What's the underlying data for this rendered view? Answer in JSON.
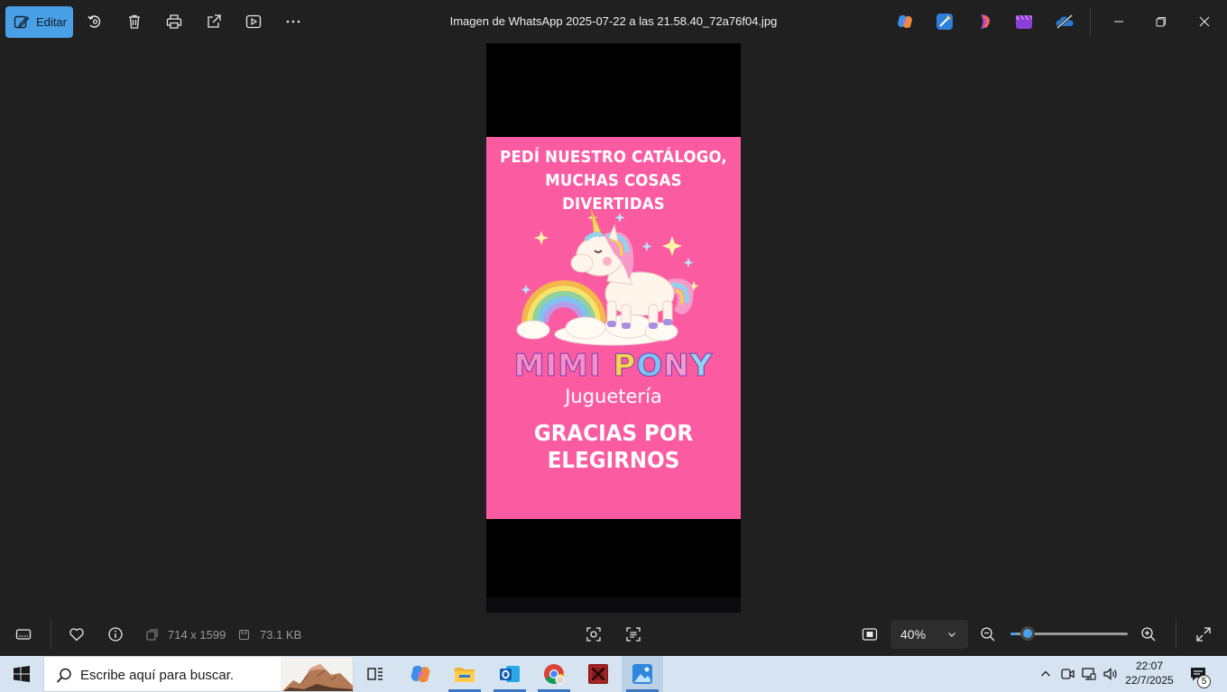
{
  "toolbar": {
    "edit_label": "Editar",
    "window_title": "Imagen de WhatsApp 2025-07-22 a las 21.58.40_72a76f04.jpg",
    "icons": [
      "edit-icon",
      "rotate-icon",
      "delete-icon",
      "print-icon",
      "share-icon",
      "slideshow-icon",
      "more-icon"
    ],
    "app_icons": [
      "copilot-icon",
      "designer-icon",
      "clipchamp-icon",
      "video-editor-icon",
      "onedrive-icon"
    ]
  },
  "image": {
    "headline_line1": "PEDÍ NUESTRO CATÁLOGO,",
    "headline_line2": "MUCHAS COSAS DIVERTIDAS",
    "brand_part1": "MIMI",
    "brand_part2": "PONY",
    "subtitle": "Juguetería",
    "thanks_line1": "GRACIAS POR",
    "thanks_line2": "ELEGIRNOS",
    "colors": {
      "background": "#fb5ca1",
      "mimi": "#f78fc4",
      "pony_p": "#f5d64a",
      "pony_o": "#79c6f2",
      "pony_n": "#f59ac9",
      "pony_y": "#8fd5ee"
    }
  },
  "bottombar": {
    "dimensions": "714 x 1599",
    "file_size": "73.1 KB",
    "zoom_value": "40%",
    "zoom_level_fraction": 0.05
  },
  "taskbar": {
    "search_placeholder": "Escribe aquí para buscar.",
    "time": "22:07",
    "date": "22/7/2025",
    "notification_count": "5"
  }
}
